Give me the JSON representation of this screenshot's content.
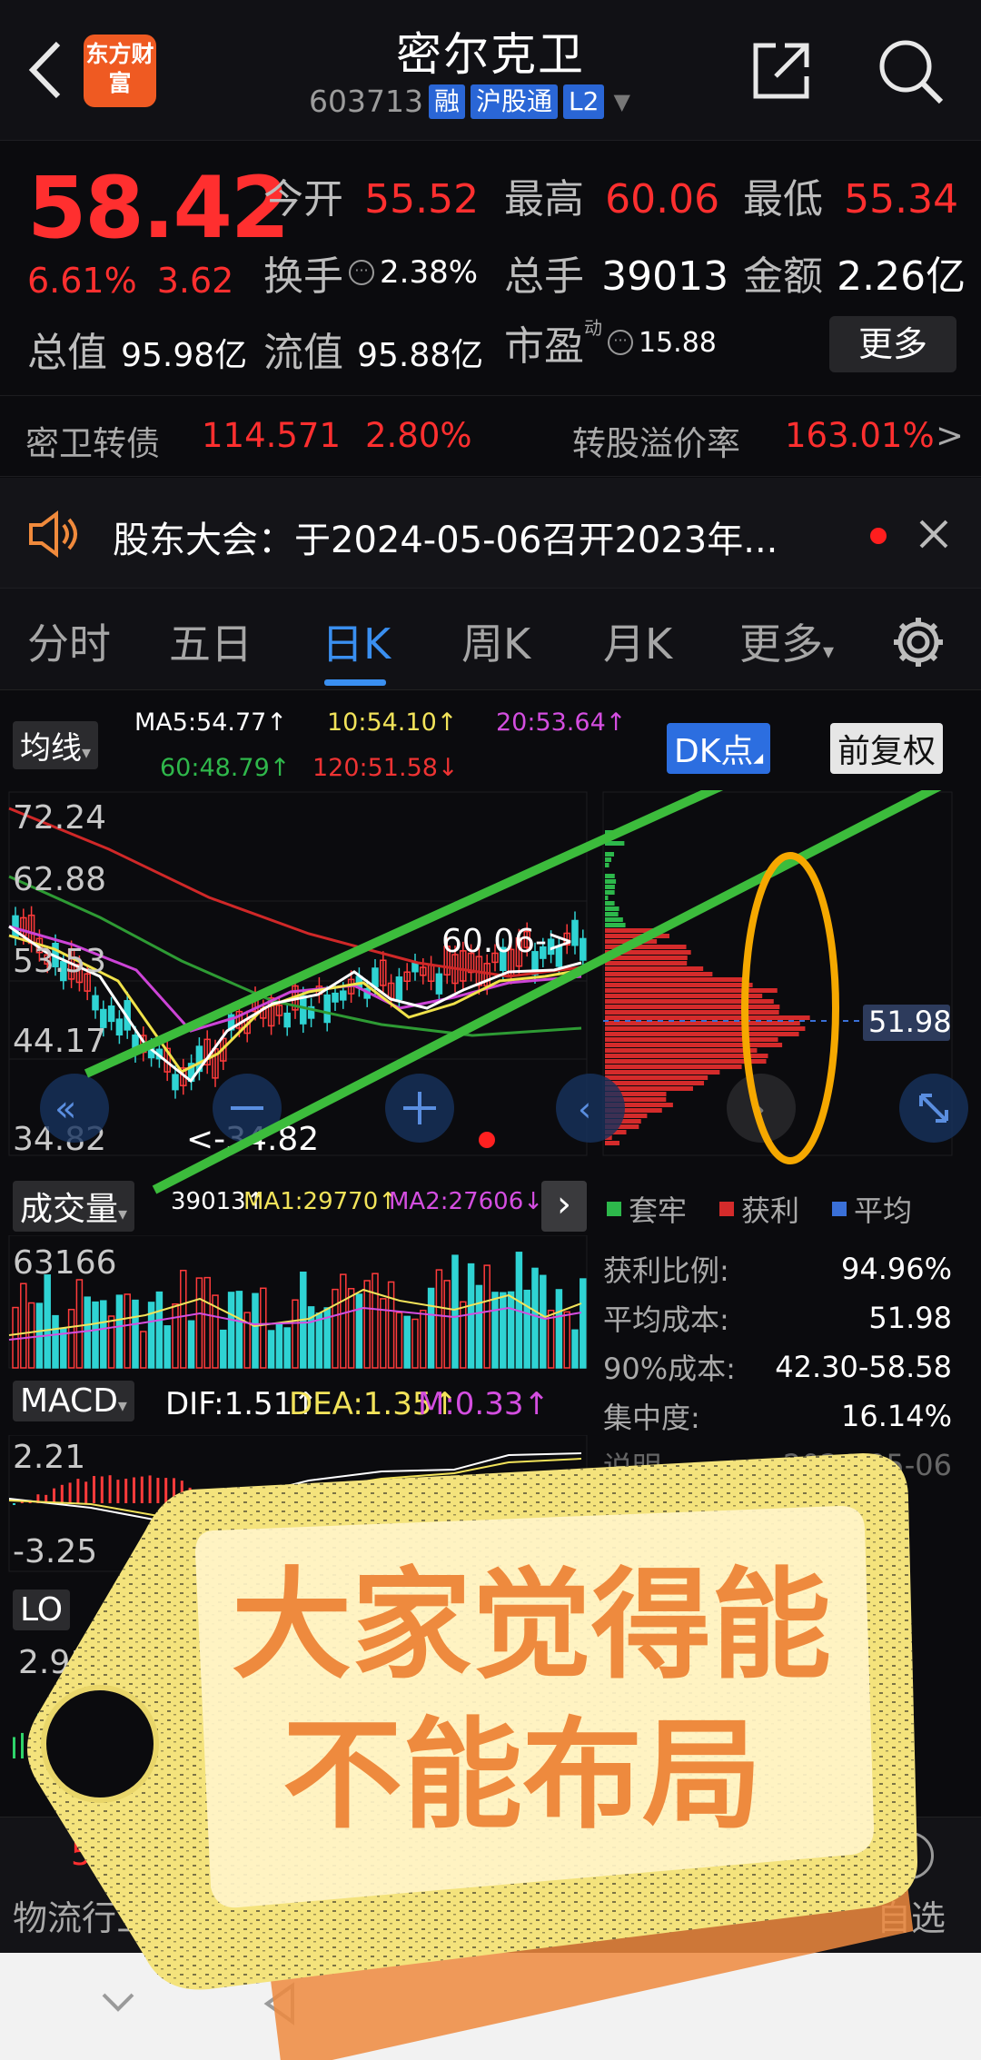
{
  "header": {
    "back_icon": "chevron-left-icon",
    "logo_text": "东方财富",
    "title": "密尔克卫",
    "code": "603713",
    "tags": [
      "融",
      "沪股通",
      "L2"
    ]
  },
  "quote": {
    "price": "58.42",
    "change_pct": "6.61%",
    "change_amt": "3.62",
    "open_label": "今开",
    "open": "55.52",
    "high_label": "最高",
    "high": "60.06",
    "low_label": "最低",
    "low": "55.34",
    "turnover_label": "换手",
    "turnover": "2.38%",
    "volume_label": "总手",
    "volume": "39013",
    "amount_label": "金额",
    "amount": "2.26亿",
    "mcap_label": "总值",
    "mcap": "95.98亿",
    "float_label": "流值",
    "float": "95.88亿",
    "pe_label": "市盈",
    "pe_sup": "动",
    "pe": "15.88",
    "more_label": "更多"
  },
  "bond": {
    "name": "密卫转债",
    "price": "114.571",
    "pct": "2.80%",
    "premium_label": "转股溢价率",
    "premium": "163.01%",
    "arrow": ">"
  },
  "notice": {
    "text": "股东大会：于2024-05-06召开2023年..."
  },
  "tabs": [
    "分时",
    "五日",
    "日K",
    "周K",
    "月K",
    "更多"
  ],
  "chart": {
    "ma_selector": "均线",
    "ma5": "MA5:54.77↑",
    "ma10": "10:54.10↑",
    "ma20": "20:53.64↑",
    "ma60": "60:48.79↑",
    "ma120": "120:51.58↓",
    "dk_button": "DK点",
    "fq_button": "前复权",
    "y_labels": [
      "72.24",
      "62.88",
      "53.53",
      "44.17",
      "34.82"
    ],
    "high_mark": "60.06->",
    "low_mark": "<-34.82",
    "cost_price": "51.98",
    "vol_selector": "成交量",
    "vol": "39013↑",
    "vol_ma1": "MA1:29770↑",
    "vol_ma2": "MA2:27606↓",
    "vol_max": "63166",
    "macd_selector": "MACD",
    "dif": "DIF:1.51↑",
    "dea": "DEA:1.35↑",
    "m": "M:0.33↑",
    "macd_top": "2.21",
    "macd_bottom": "-3.25",
    "third_selector": "LO",
    "third_value": "2.91",
    "legend": {
      "trap": "套牢",
      "profit": "获利",
      "avg": "平均"
    },
    "stats": [
      {
        "k": "获利比例:",
        "v": "94.96%"
      },
      {
        "k": "平均成本:",
        "v": "51.98"
      },
      {
        "k": "90%成本:",
        "v": "42.30-58.58"
      },
      {
        "k": "集中度:",
        "v": "16.14%"
      }
    ],
    "note_label": "说明",
    "note_date": "2024-05-06"
  },
  "bottom": {
    "left_value": "57",
    "left_label": "物流行业",
    "right_label": "自选"
  },
  "sticker": {
    "line1": "大家觉得能",
    "line2": "不能布局"
  },
  "colors": {
    "up": "#ff2f2f",
    "accent": "#3a8ff0",
    "green_line": "#3bbf3b",
    "orange": "#f5a800",
    "sticker": "#f4e37c",
    "sticker_text": "#ee8a3e"
  }
}
